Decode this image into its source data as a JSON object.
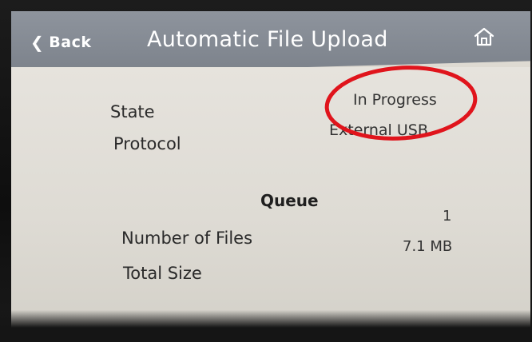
{
  "header": {
    "back_label": "Back",
    "title": "Automatic File Upload",
    "home_icon": "home-icon"
  },
  "status": {
    "state_label": "State",
    "state_value": "In Progress",
    "protocol_label": "Protocol",
    "protocol_value": "External USB"
  },
  "queue": {
    "heading": "Queue",
    "files_label": "Number of Files",
    "files_value": "1",
    "size_label": "Total Size",
    "size_value": "7.1 MB"
  },
  "colors": {
    "header": "#7f858e",
    "content": "#e2dfd8",
    "annotation": "#e0141c"
  }
}
